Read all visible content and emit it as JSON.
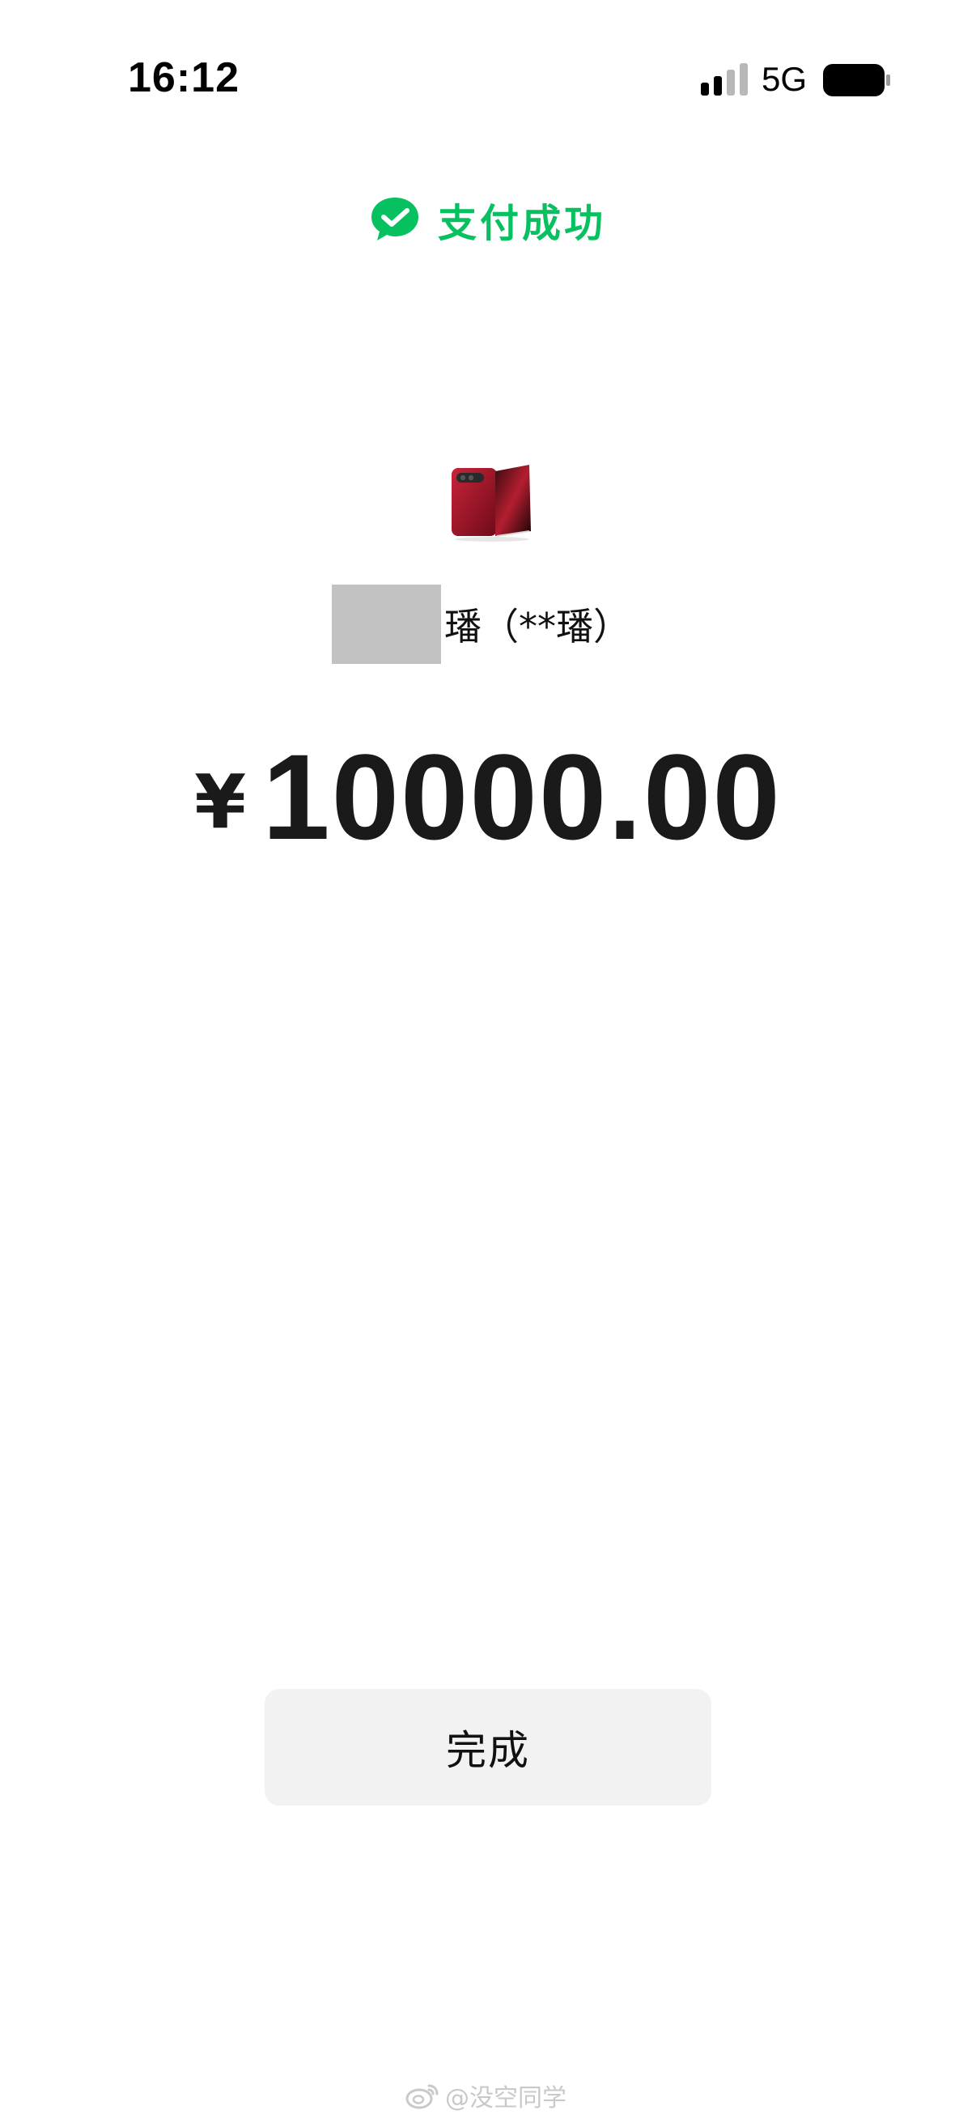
{
  "status_bar": {
    "time": "16:12",
    "network": "5G",
    "signal_icon": "cellular-signal-icon",
    "battery_icon": "battery-icon"
  },
  "header": {
    "icon": "wechat-pay-check-icon",
    "title": "支付成功",
    "accent_color": "#07c160"
  },
  "merchant": {
    "avatar_icon": "merchant-avatar-phone-image",
    "name": "璠（**璠）"
  },
  "payment": {
    "currency_symbol": "¥",
    "amount": "10000.00"
  },
  "actions": {
    "done_label": "完成"
  },
  "watermark": {
    "icon": "weibo-icon",
    "text": "@没空同学"
  }
}
